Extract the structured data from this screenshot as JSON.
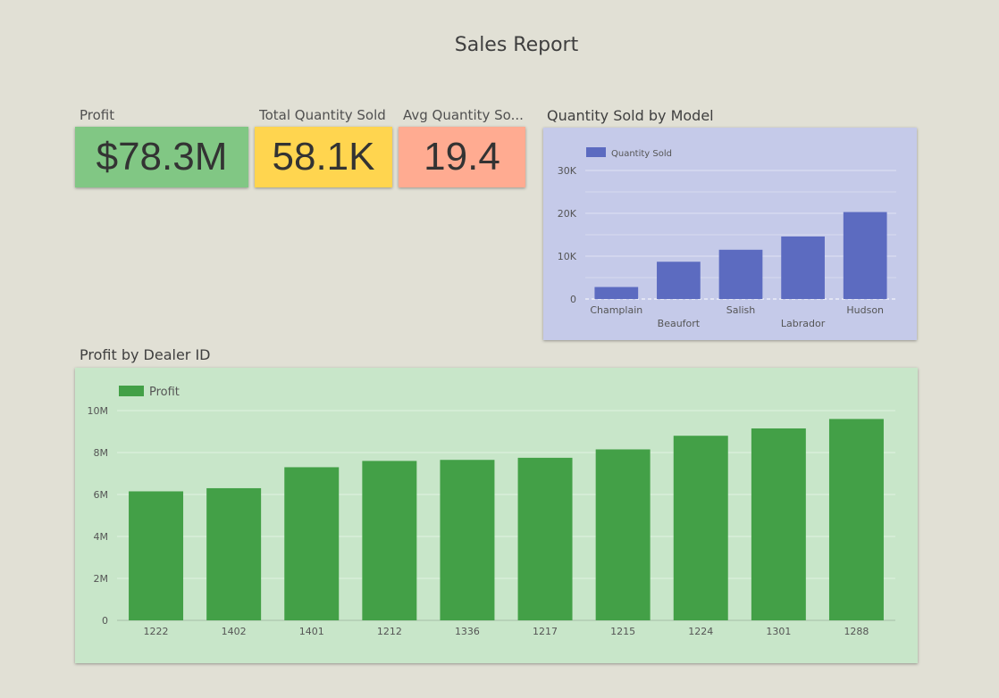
{
  "report": {
    "title": "Sales Report"
  },
  "kpis": [
    {
      "label": "Profit",
      "value": "$78.3M",
      "color": "#81c784"
    },
    {
      "label": "Total Quantity Sold",
      "value": "58.1K",
      "color": "#ffd54f"
    },
    {
      "label": "Avg Quantity So...",
      "value": "19.4",
      "color": "#ffab91"
    }
  ],
  "charts": {
    "quantity_by_model": {
      "title": "Quantity Sold by Model",
      "background": "#c5cae9",
      "bar_color": "#5c6bc0"
    },
    "profit_by_dealer": {
      "title": "Profit by Dealer ID",
      "background": "#c8e6c9",
      "bar_color": "#43a047"
    }
  },
  "chart_data": [
    {
      "type": "bar",
      "title": "Quantity Sold by Model",
      "categories": [
        "Champlain",
        "Beaufort",
        "Salish",
        "Labrador",
        "Hudson"
      ],
      "series": [
        {
          "name": "Quantity Sold",
          "values": [
            2800,
            8700,
            11500,
            14600,
            20300
          ]
        }
      ],
      "ylim": [
        0,
        30000
      ],
      "yticks": [
        0,
        10000,
        20000,
        30000
      ],
      "ytick_labels": [
        "0",
        "10K",
        "20K",
        "30K"
      ],
      "grid": true,
      "legend": "top-left"
    },
    {
      "type": "bar",
      "title": "Profit by Dealer ID",
      "categories": [
        "1222",
        "1402",
        "1401",
        "1212",
        "1336",
        "1217",
        "1215",
        "1224",
        "1301",
        "1288"
      ],
      "series": [
        {
          "name": "Profit",
          "values": [
            6150000,
            6300000,
            7300000,
            7600000,
            7650000,
            7750000,
            8150000,
            8800000,
            9150000,
            9600000
          ]
        }
      ],
      "ylim": [
        0,
        10000000
      ],
      "yticks": [
        0,
        2000000,
        4000000,
        6000000,
        8000000,
        10000000
      ],
      "ytick_labels": [
        "0",
        "2M",
        "4M",
        "6M",
        "8M",
        "10M"
      ],
      "grid": true,
      "legend": "top-left"
    }
  ]
}
